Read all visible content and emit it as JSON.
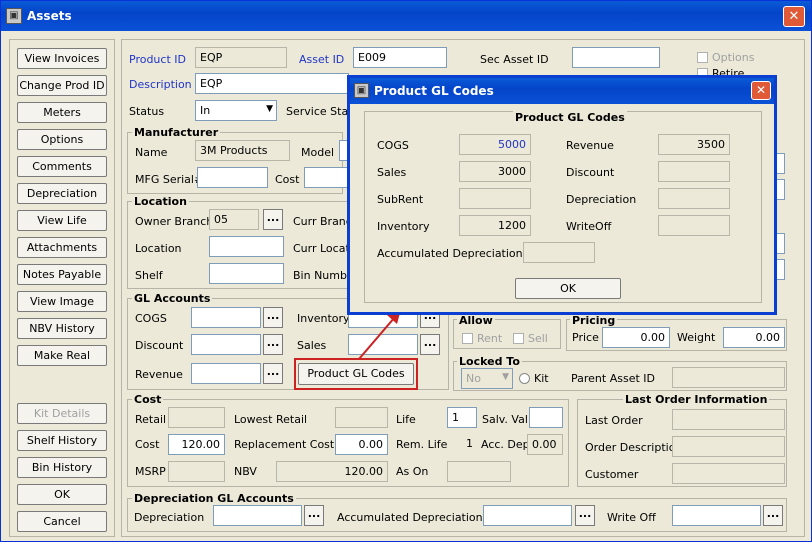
{
  "window": {
    "title": "Assets",
    "close": "✕"
  },
  "left_buttons": [
    "View Invoices",
    "Change Prod ID",
    "Meters",
    "Options",
    "Comments",
    "Depreciation",
    "View Life",
    "Attachments",
    "Notes Payable",
    "View Image",
    "NBV History",
    "Make Real"
  ],
  "left_buttons_bottom": {
    "kit_details": "Kit Details",
    "shelf_history": "Shelf History",
    "bin_history": "Bin History",
    "ok": "OK",
    "cancel": "Cancel"
  },
  "header": {
    "product_id_label": "Product ID",
    "product_id": "EQP",
    "asset_id_label": "Asset ID",
    "asset_id": "E009",
    "sec_asset_id_label": "Sec Asset ID",
    "sec_asset_id": "",
    "description_label": "Description",
    "description": "EQP",
    "status_label": "Status",
    "status": "In",
    "service_status_label": "Service Status",
    "options_label": "Options",
    "retire_label": "Retire"
  },
  "manufacturer": {
    "title": "Manufacturer",
    "name_label": "Name",
    "name": "3M Products",
    "model_label": "Model",
    "serial_label": "MFG Serial#",
    "cost_label": "Cost"
  },
  "location": {
    "title": "Location",
    "owner_branch_label": "Owner Branch",
    "owner_branch": "05",
    "curr_branch_label": "Curr Branch",
    "location_label": "Location",
    "curr_location_label": "Curr Location",
    "shelf_label": "Shelf",
    "bin_number_label": "Bin Number"
  },
  "gl_accounts": {
    "title": "GL Accounts",
    "cogs_label": "COGS",
    "inventory_label": "Inventory",
    "discount_label": "Discount",
    "sales_label": "Sales",
    "revenue_label": "Revenue",
    "product_gl_button": "Product GL Codes"
  },
  "allow": {
    "title": "Allow",
    "rent": "Rent",
    "sell": "Sell"
  },
  "pricing": {
    "title": "Pricing",
    "price_label": "Price",
    "price": "0.00",
    "weight_label": "Weight",
    "weight": "0.00"
  },
  "locked": {
    "title": "Locked To",
    "value": "No",
    "kit_label": "Kit",
    "parent_label": "Parent Asset ID"
  },
  "cost": {
    "title": "Cost",
    "retail_label": "Retail",
    "lowest_retail_label": "Lowest Retail",
    "life_label": "Life",
    "life": "1",
    "salv_label": "Salv. Val",
    "cost_label": "Cost",
    "cost": "120.00",
    "replacement_label": "Replacement Cost",
    "replacement": "0.00",
    "rem_life_label": "Rem. Life",
    "rem_life": "1",
    "acc_dep_label": "Acc. Dep",
    "acc_dep": "0.00",
    "msrp_label": "MSRP",
    "nbv_label": "NBV",
    "nbv": "120.00",
    "as_on_label": "As On"
  },
  "last_order": {
    "title": "Last Order Information",
    "last_order_label": "Last Order",
    "order_desc_label": "Order Description",
    "customer_label": "Customer"
  },
  "dep_gl": {
    "title": "Depreciation GL Accounts",
    "depreciation_label": "Depreciation",
    "accumulated_label": "Accumulated Depreciation",
    "write_off_label": "Write Off"
  },
  "dialog": {
    "title": "Product GL Codes",
    "heading": "Product GL Codes",
    "cogs_label": "COGS",
    "cogs": "5000",
    "revenue_label": "Revenue",
    "revenue": "3500",
    "sales_label": "Sales",
    "sales": "3000",
    "discount_label": "Discount",
    "discount": "",
    "subrent_label": "SubRent",
    "subrent": "",
    "depreciation_label": "Depreciation",
    "depreciation": "",
    "inventory_label": "Inventory",
    "inventory": "1200",
    "writeoff_label": "WriteOff",
    "writeoff": "",
    "acc_dep_label": "Accumulated Depreciation",
    "acc_dep": "",
    "ok": "OK"
  },
  "colors": {
    "title_bar": "#0444c9",
    "highlight": "#cc2222",
    "label_blue": "#1f35c9"
  }
}
